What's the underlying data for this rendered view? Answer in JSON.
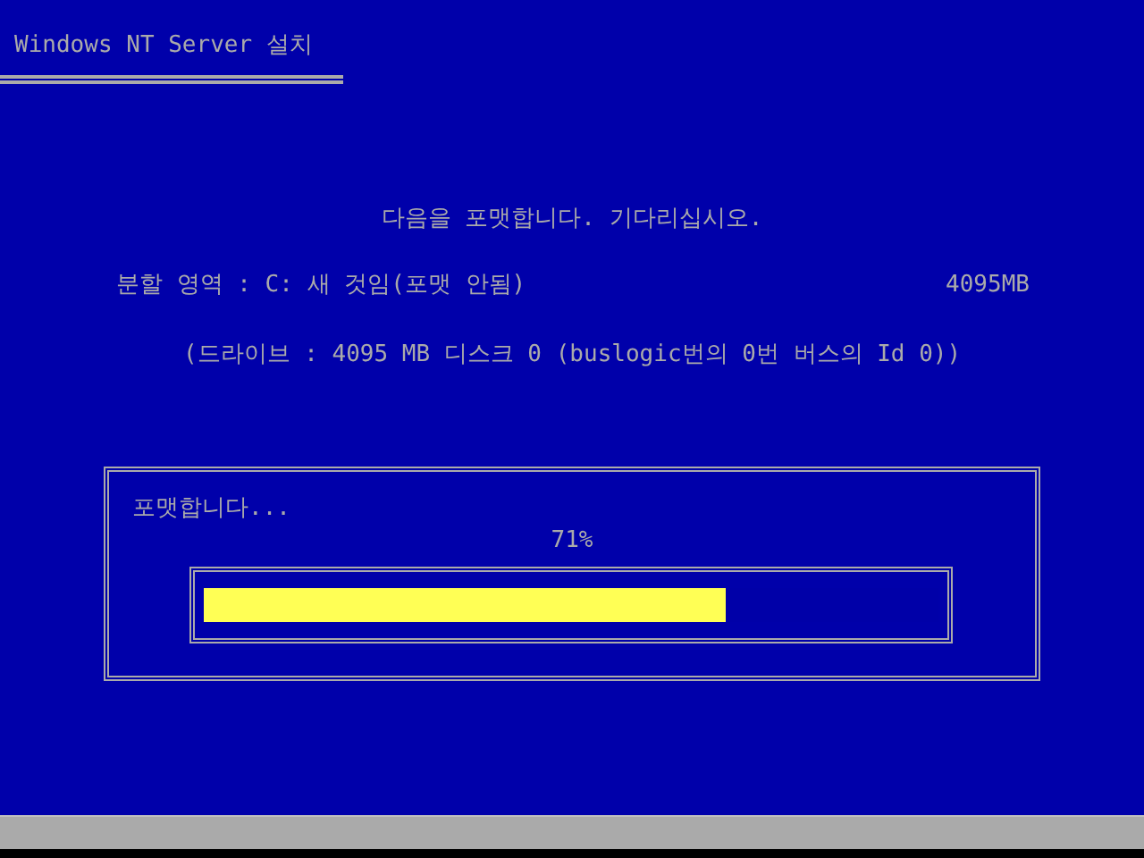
{
  "window": {
    "title": "Windows NT Server 설치"
  },
  "message": "다음을 포맷합니다. 기다리십시오.",
  "partition": {
    "label": "분할 영역 : C: 새 것임(포맷 안됨)",
    "size": "4095MB"
  },
  "drive": "(드라이브 : 4095 MB 디스크 0 (buslogic번의 0번 버스의 Id 0))",
  "progress": {
    "caption": "포맷합니다...",
    "reading": "71%",
    "level": 0.71
  }
}
